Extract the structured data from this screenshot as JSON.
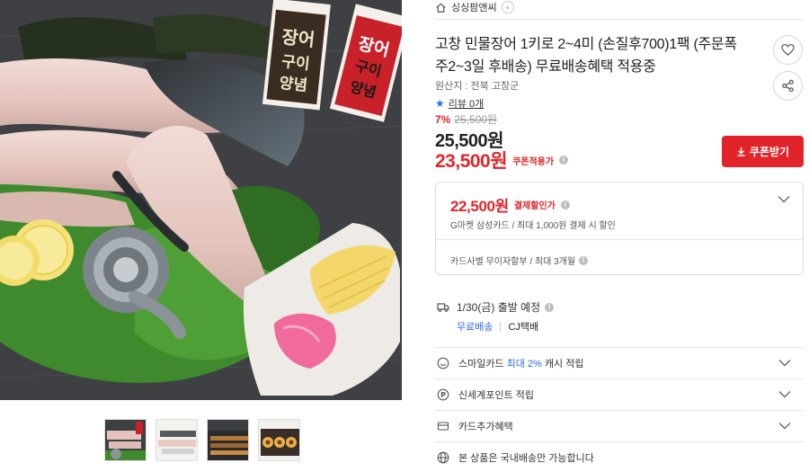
{
  "seller": {
    "name": "싱싱팜앤씨"
  },
  "product": {
    "title": "고창 민물장어 1키로 2~4미 (손질후700)1팩 (주문폭주2~3일 후배송) 무료배송혜택 적용중",
    "origin": "원산지 : 전북 고창군",
    "review_label": "리뷰 0개",
    "package_text": "장어구이양념"
  },
  "price": {
    "discount_pct": "7%",
    "original": "25,500원",
    "main": "25,500원",
    "coupon_price": "23,500원",
    "coupon_label": "쿠폰적용가",
    "coupon_button": "쿠폰받기"
  },
  "card_benefit": {
    "price": "22,500원",
    "label": "결제할인가",
    "desc": "G마켓 삼성카드 / 최대 1,000원 결제 시 할인",
    "installment": "카드사별 무이자할부 / 최대 3개월"
  },
  "shipping": {
    "date": "1/30(금) 출발 예정",
    "free": "무료배송",
    "carrier": "CJ택배"
  },
  "benefits": {
    "smile_pre": "스마일카드",
    "smile_hl": "최대 2%",
    "smile_post": "캐시 적립",
    "shinsegae": "신세계포인트 적립",
    "card_extra": "카드추가혜택",
    "domestic": "본 상품은 국내배송만 가능합니다"
  },
  "colors": {
    "accent_red": "#e2242a",
    "accent_blue": "#2c6de5"
  }
}
